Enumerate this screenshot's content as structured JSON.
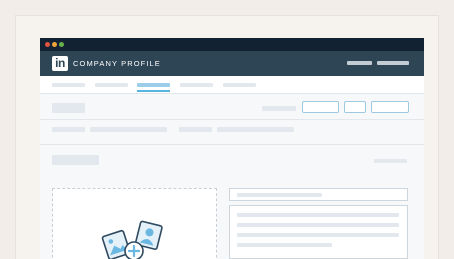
{
  "window": {
    "controls": {
      "close_color": "#e0533f",
      "minimize_color": "#f2a33a",
      "maximize_color": "#69b04b"
    }
  },
  "appbar": {
    "logo_text": "in",
    "title": "COMPANY PROFILE",
    "background": "#2d4555"
  },
  "tabs": {
    "active_index": 2,
    "accent": "#5ab4e0"
  },
  "upload": {
    "icons": [
      "image-icon",
      "person-icon",
      "plus-icon"
    ]
  }
}
